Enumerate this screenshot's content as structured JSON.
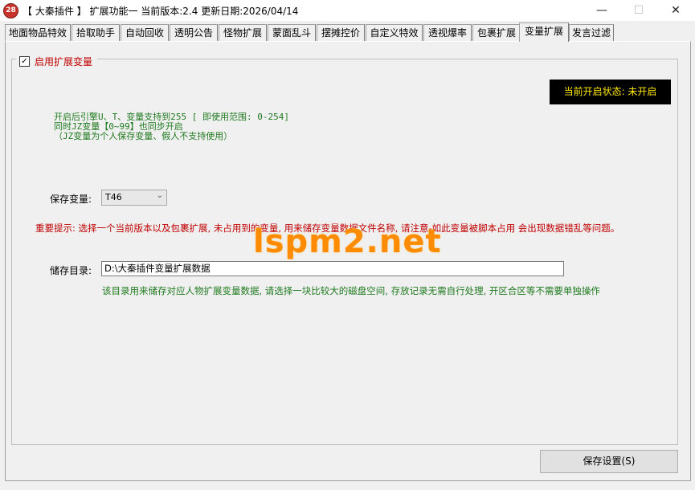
{
  "window": {
    "icon_text": "28",
    "title": "【 大秦插件 】 扩展功能一 当前版本:2.4 更新日期:2026/04/14",
    "minimize_glyph": "—",
    "maximize_glyph": "☐",
    "close_glyph": "✕"
  },
  "tabs": [
    {
      "label": "地面物品特效"
    },
    {
      "label": "拾取助手"
    },
    {
      "label": "自动回收"
    },
    {
      "label": "透明公告"
    },
    {
      "label": "怪物扩展"
    },
    {
      "label": "蒙面乱斗"
    },
    {
      "label": "摆摊控价"
    },
    {
      "label": "自定义特效"
    },
    {
      "label": "透视爆率"
    },
    {
      "label": "包裹扩展"
    },
    {
      "label": "变量扩展",
      "active": true
    },
    {
      "label": "发言过滤"
    }
  ],
  "enable": {
    "label": "启用扩展变量",
    "checked": true,
    "check_glyph": "✓"
  },
  "status": {
    "text": "当前开启状态: 未开启"
  },
  "info_lines": [
    "开启后引擎U、T、变量支持到255 [ 即使用范围: 0-254]",
    "同时JZ变量【0~99】也同步开启",
    "（JZ变量为个人保存变量、假人不支持使用）"
  ],
  "save_var": {
    "label": "保存变量:",
    "value": "T46",
    "chevron": "⌄"
  },
  "warning": "重要提示: 选择一个当前版本以及包裹扩展, 未占用到的变量, 用来储存变量数据文件名称, 请注意-如此变量被脚本占用 会出现数据错乱等问题。",
  "watermark": "lspm2.net",
  "storage": {
    "label": "储存目录:",
    "value": "D:\\大秦插件变量扩展数据",
    "note": "该目录用来储存对应人物扩展变量数据, 请选择一块比较大的磁盘空间, 存放记录无需自行处理, 开区合区等不需要单独操作"
  },
  "save_button": "保存设置(S)",
  "colors": {
    "accent_red": "#c00000",
    "info_green": "#1f7a1f",
    "status_bg": "#000000",
    "status_fg": "#ffea00",
    "watermark": "#ff8c00"
  }
}
